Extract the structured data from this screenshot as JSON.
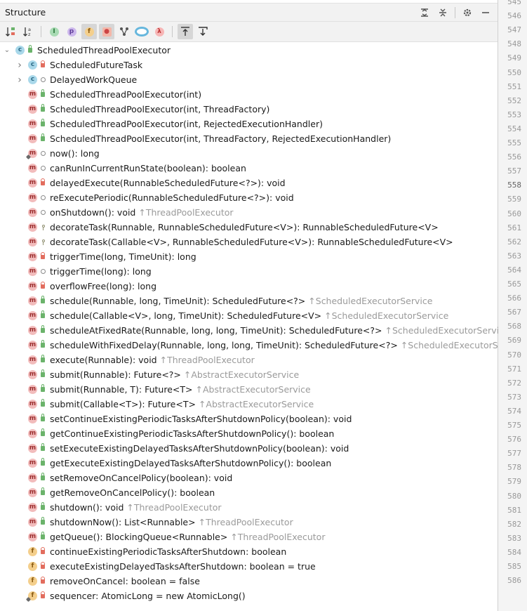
{
  "panel": {
    "title": "Structure"
  },
  "header_icons": [
    "expand-all-icon",
    "collapse-all-icon",
    "settings-icon",
    "minimize-icon"
  ],
  "toolbar_icons": [
    "sort-by-visibility",
    "sort-alphabetically",
    "show-inherited",
    "show-properties",
    "show-fields",
    "show-non-public",
    "show-lambdas",
    "show-anonymous",
    "show-lambda",
    "autoscroll-to-source",
    "autoscroll-from-source"
  ],
  "tree": [
    {
      "depth": 0,
      "expand": "open",
      "kind": "c",
      "vis": "pub",
      "label": "ScheduledThreadPoolExecutor",
      "inherited": ""
    },
    {
      "depth": 1,
      "expand": "closed",
      "kind": "c",
      "vis": "priv",
      "label": "ScheduledFutureTask",
      "inherited": ""
    },
    {
      "depth": 1,
      "expand": "closed",
      "kind": "c",
      "vis": "pkg",
      "label": "DelayedWorkQueue",
      "inherited": ""
    },
    {
      "depth": 1,
      "kind": "m",
      "vis": "pub",
      "label": "ScheduledThreadPoolExecutor(int)",
      "inherited": ""
    },
    {
      "depth": 1,
      "kind": "m",
      "vis": "pub",
      "label": "ScheduledThreadPoolExecutor(int, ThreadFactory)",
      "inherited": ""
    },
    {
      "depth": 1,
      "kind": "m",
      "vis": "pub",
      "label": "ScheduledThreadPoolExecutor(int, RejectedExecutionHandler)",
      "inherited": ""
    },
    {
      "depth": 1,
      "kind": "m",
      "vis": "pub",
      "label": "ScheduledThreadPoolExecutor(int, ThreadFactory, RejectedExecutionHandler)",
      "inherited": ""
    },
    {
      "depth": 1,
      "kind": "m",
      "pin": true,
      "vis": "pkg",
      "label": "now(): long",
      "inherited": ""
    },
    {
      "depth": 1,
      "kind": "m",
      "vis": "pkg",
      "label": "canRunInCurrentRunState(boolean): boolean",
      "inherited": ""
    },
    {
      "depth": 1,
      "kind": "m",
      "vis": "priv",
      "label": "delayedExecute(RunnableScheduledFuture<?>): void",
      "inherited": ""
    },
    {
      "depth": 1,
      "kind": "m",
      "vis": "pkg",
      "label": "reExecutePeriodic(RunnableScheduledFuture<?>): void",
      "inherited": ""
    },
    {
      "depth": 1,
      "kind": "m",
      "vis": "pkg",
      "label": "onShutdown(): void",
      "inherited": "ThreadPoolExecutor"
    },
    {
      "depth": 1,
      "kind": "m",
      "vis": "prot",
      "label": "decorateTask(Runnable, RunnableScheduledFuture<V>): RunnableScheduledFuture<V>",
      "inherited": ""
    },
    {
      "depth": 1,
      "kind": "m",
      "vis": "prot",
      "label": "decorateTask(Callable<V>, RunnableScheduledFuture<V>): RunnableScheduledFuture<V>",
      "inherited": ""
    },
    {
      "depth": 1,
      "kind": "m",
      "vis": "priv",
      "label": "triggerTime(long, TimeUnit): long",
      "inherited": ""
    },
    {
      "depth": 1,
      "kind": "m",
      "vis": "pkg",
      "label": "triggerTime(long): long",
      "inherited": ""
    },
    {
      "depth": 1,
      "kind": "m",
      "vis": "priv",
      "label": "overflowFree(long): long",
      "inherited": ""
    },
    {
      "depth": 1,
      "kind": "m",
      "vis": "pub",
      "label": "schedule(Runnable, long, TimeUnit): ScheduledFuture<?>",
      "inherited": "ScheduledExecutorService"
    },
    {
      "depth": 1,
      "kind": "m",
      "vis": "pub",
      "label": "schedule(Callable<V>, long, TimeUnit): ScheduledFuture<V>",
      "inherited": "ScheduledExecutorService"
    },
    {
      "depth": 1,
      "kind": "m",
      "vis": "pub",
      "label": "scheduleAtFixedRate(Runnable, long, long, TimeUnit): ScheduledFuture<?>",
      "inherited": "ScheduledExecutorService"
    },
    {
      "depth": 1,
      "kind": "m",
      "vis": "pub",
      "label": "scheduleWithFixedDelay(Runnable, long, long, TimeUnit): ScheduledFuture<?>",
      "inherited": "ScheduledExecutorService"
    },
    {
      "depth": 1,
      "kind": "m",
      "vis": "pub",
      "label": "execute(Runnable): void",
      "inherited": "ThreadPoolExecutor"
    },
    {
      "depth": 1,
      "kind": "m",
      "vis": "pub",
      "label": "submit(Runnable): Future<?>",
      "inherited": "AbstractExecutorService"
    },
    {
      "depth": 1,
      "kind": "m",
      "vis": "pub",
      "label": "submit(Runnable, T): Future<T>",
      "inherited": "AbstractExecutorService"
    },
    {
      "depth": 1,
      "kind": "m",
      "vis": "pub",
      "label": "submit(Callable<T>): Future<T>",
      "inherited": "AbstractExecutorService"
    },
    {
      "depth": 1,
      "kind": "m",
      "vis": "pub",
      "label": "setContinueExistingPeriodicTasksAfterShutdownPolicy(boolean): void",
      "inherited": ""
    },
    {
      "depth": 1,
      "kind": "m",
      "vis": "pub",
      "label": "getContinueExistingPeriodicTasksAfterShutdownPolicy(): boolean",
      "inherited": ""
    },
    {
      "depth": 1,
      "kind": "m",
      "vis": "pub",
      "label": "setExecuteExistingDelayedTasksAfterShutdownPolicy(boolean): void",
      "inherited": ""
    },
    {
      "depth": 1,
      "kind": "m",
      "vis": "pub",
      "label": "getExecuteExistingDelayedTasksAfterShutdownPolicy(): boolean",
      "inherited": ""
    },
    {
      "depth": 1,
      "kind": "m",
      "vis": "pub",
      "label": "setRemoveOnCancelPolicy(boolean): void",
      "inherited": ""
    },
    {
      "depth": 1,
      "kind": "m",
      "vis": "pub",
      "label": "getRemoveOnCancelPolicy(): boolean",
      "inherited": ""
    },
    {
      "depth": 1,
      "kind": "m",
      "vis": "pub",
      "label": "shutdown(): void",
      "inherited": "ThreadPoolExecutor"
    },
    {
      "depth": 1,
      "kind": "m",
      "vis": "pub",
      "label": "shutdownNow(): List<Runnable>",
      "inherited": "ThreadPoolExecutor"
    },
    {
      "depth": 1,
      "kind": "m",
      "vis": "pub",
      "label": "getQueue(): BlockingQueue<Runnable>",
      "inherited": "ThreadPoolExecutor"
    },
    {
      "depth": 1,
      "kind": "f",
      "vis": "priv",
      "label": "continueExistingPeriodicTasksAfterShutdown: boolean",
      "inherited": ""
    },
    {
      "depth": 1,
      "kind": "f",
      "vis": "priv",
      "label": "executeExistingDelayedTasksAfterShutdown: boolean = true",
      "inherited": ""
    },
    {
      "depth": 1,
      "kind": "f",
      "vis": "priv",
      "label": "removeOnCancel: boolean = false",
      "inherited": ""
    },
    {
      "depth": 1,
      "kind": "f",
      "pin": true,
      "vis": "priv",
      "label": "sequencer: AtomicLong = new AtomicLong()",
      "inherited": ""
    }
  ],
  "gutter": {
    "lines": [
      "545",
      "546",
      "547",
      "548",
      "549",
      "550",
      "551",
      "552",
      "553",
      "554",
      "555",
      "556",
      "557",
      "558",
      "559",
      "560",
      "561",
      "562",
      "563",
      "564",
      "565",
      "566",
      "567",
      "568",
      "569",
      "570",
      "571",
      "572",
      "573",
      "574",
      "575",
      "576",
      "577",
      "578",
      "579",
      "580",
      "581",
      "582",
      "583",
      "584",
      "585",
      "586"
    ],
    "current": "558"
  }
}
